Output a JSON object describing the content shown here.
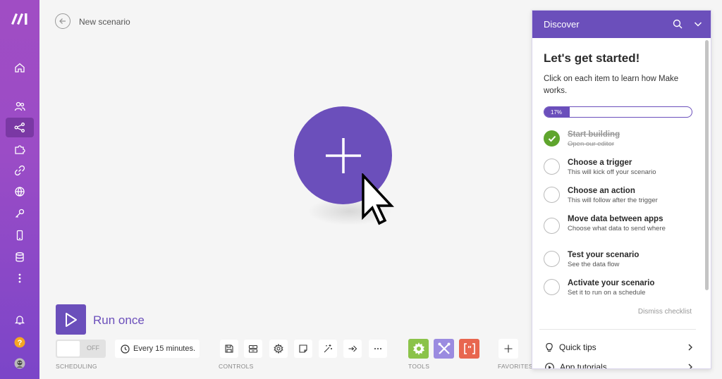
{
  "canvas": {
    "scenario_name": "New scenario"
  },
  "toolbar": {
    "run_label": "Run once",
    "toggle_state": "OFF",
    "schedule": "Every 15 minutes.",
    "labels": {
      "scheduling": "SCHEDULING",
      "controls": "CONTROLS",
      "tools": "TOOLS",
      "favorites": "FAVORITES"
    },
    "controls": [
      "save-icon",
      "scenario-io-icon",
      "settings-gear-icon",
      "notes-icon",
      "auto-align-icon",
      "flow-control-icon",
      "more-dots-icon"
    ],
    "tools": [
      {
        "icon": "gear-icon",
        "color": "#8bc34a"
      },
      {
        "icon": "tools-icon",
        "color": "#9b8be0"
      },
      {
        "icon": "json-brackets-icon",
        "color": "#e8664f"
      }
    ]
  },
  "sidebar": {
    "items": [
      "home-icon",
      "team-icon",
      "scenarios-icon",
      "templates-icon",
      "connections-icon",
      "webhooks-icon",
      "keys-icon",
      "devices-icon",
      "data-stores-icon",
      "more-icon"
    ],
    "active": "scenarios-icon",
    "bottom": [
      "notifications-icon",
      "help-icon",
      "avatar"
    ]
  },
  "discover": {
    "title": "Discover",
    "heading": "Let's get started!",
    "intro": "Click on each item to learn how Make works.",
    "progress_percent": 17,
    "progress_text": "17%",
    "items": [
      {
        "title": "Start building",
        "subtitle": "Open our editor",
        "done": true
      },
      {
        "title": "Choose a trigger",
        "subtitle": "This will kick off your scenario",
        "done": false
      },
      {
        "title": "Choose an action",
        "subtitle": "This will follow after the trigger",
        "done": false
      },
      {
        "title": "Move data between apps",
        "subtitle": "Choose what data to send where",
        "done": false
      },
      {
        "title": "Test your scenario",
        "subtitle": "See the data flow",
        "done": false
      },
      {
        "title": "Activate your scenario",
        "subtitle": "Set it to run on a schedule",
        "done": false
      }
    ],
    "dismiss": "Dismiss checklist",
    "links": [
      {
        "label": "Quick tips",
        "icon": "lightbulb-icon"
      },
      {
        "label": "App tutorials",
        "icon": "play-circle-icon"
      }
    ]
  },
  "colors": {
    "accent": "#6b4fbb",
    "success": "#5fa52d"
  }
}
